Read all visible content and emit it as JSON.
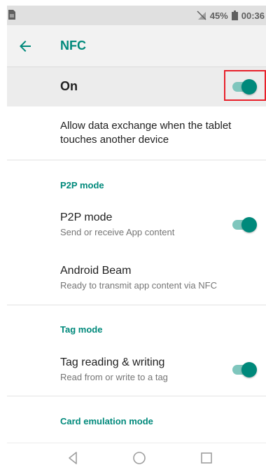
{
  "status_bar": {
    "battery_percent": "45%",
    "time": "00:36",
    "icons": [
      "sim-card-icon",
      "no-signal-icon",
      "battery-icon"
    ]
  },
  "app_bar": {
    "title": "NFC",
    "back_icon": "arrow-back-icon"
  },
  "master_switch": {
    "label": "On",
    "checked": true
  },
  "description": "Allow data exchange when the tablet touches another device",
  "sections": {
    "p2p": {
      "header": "P2P mode",
      "items": [
        {
          "title": "P2P mode",
          "subtitle": "Send or receive App content",
          "has_switch": true,
          "checked": true
        },
        {
          "title": "Android Beam",
          "subtitle": "Ready to transmit app content via NFC",
          "has_switch": false
        }
      ]
    },
    "tag": {
      "header": "Tag mode",
      "items": [
        {
          "title": "Tag reading & writing",
          "subtitle": "Read from or write to a tag",
          "has_switch": true,
          "checked": true
        }
      ]
    },
    "card_emulation": {
      "header": "Card emulation mode"
    }
  },
  "nav_bar": {
    "icons": [
      "nav-back-icon",
      "nav-home-icon",
      "nav-recents-icon"
    ]
  },
  "colors": {
    "accent": "#00897b",
    "switch_track": "#7fc6bd",
    "highlight_box": "#e8202a"
  }
}
